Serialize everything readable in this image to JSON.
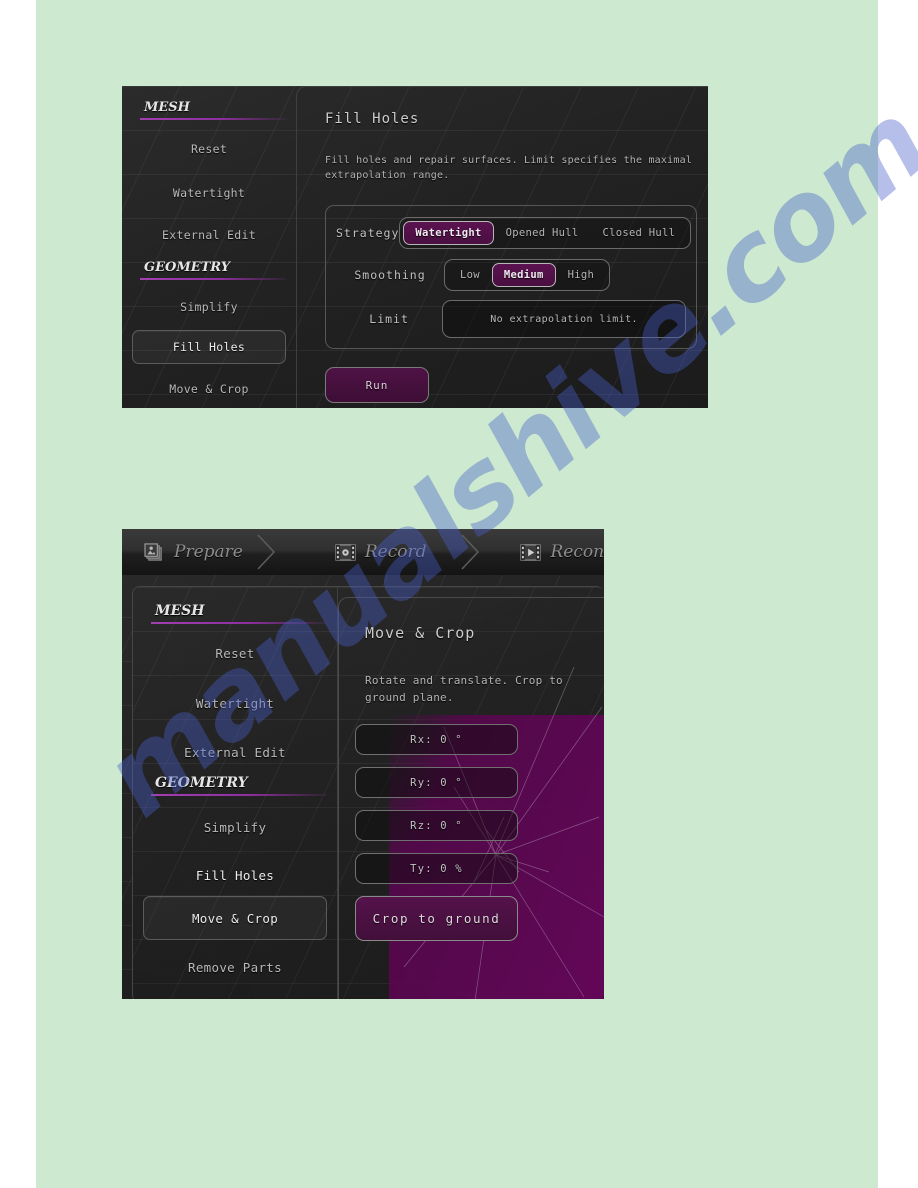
{
  "watermark": {
    "text": "manualshive.com"
  },
  "panel1": {
    "sidebar": {
      "sections": [
        {
          "heading": "MESH",
          "items": [
            {
              "label": "Reset",
              "selected": false
            },
            {
              "label": "Watertight",
              "selected": false
            },
            {
              "label": "External Edit",
              "selected": false
            }
          ]
        },
        {
          "heading": "GEOMETRY",
          "items": [
            {
              "label": "Simplify",
              "selected": false
            },
            {
              "label": "Fill Holes",
              "selected": true
            },
            {
              "label": "Move & Crop",
              "selected": false
            }
          ]
        }
      ]
    },
    "pane": {
      "title": "Fill Holes",
      "description": "Fill holes and repair surfaces. Limit specifies the maximal extrapolation range.",
      "rows": [
        {
          "label": "Strategy",
          "type": "segmented",
          "options": [
            "Watertight",
            "Opened Hull",
            "Closed Hull"
          ],
          "value": "Watertight"
        },
        {
          "label": "Smoothing",
          "type": "segmented",
          "options": [
            "Low",
            "Medium",
            "High"
          ],
          "value": "Medium"
        },
        {
          "label": "Limit",
          "type": "field",
          "value": "No extrapolation limit."
        }
      ],
      "run_label": "Run"
    }
  },
  "panel2": {
    "tabs": [
      {
        "label": "Prepare",
        "icon": "stacked-cards-icon"
      },
      {
        "label": "Record",
        "icon": "film-record-icon"
      },
      {
        "label": "Recon",
        "icon": "film-play-icon"
      }
    ],
    "sidebar": {
      "sections": [
        {
          "heading": "MESH",
          "items": [
            {
              "label": "Reset",
              "selected": false
            },
            {
              "label": "Watertight",
              "selected": false
            },
            {
              "label": "External Edit",
              "selected": false
            }
          ]
        },
        {
          "heading": "GEOMETRY",
          "items": [
            {
              "label": "Simplify",
              "selected": false
            },
            {
              "label": "Fill Holes",
              "selected": false
            },
            {
              "label": "Move & Crop",
              "selected": true
            },
            {
              "label": "Remove Parts",
              "selected": false
            }
          ]
        }
      ]
    },
    "pane": {
      "title": "Move & Crop",
      "description": "Rotate and translate. Crop to ground plane.",
      "fields": [
        {
          "label": "Rx: 0 °"
        },
        {
          "label": "Ry: 0 °"
        },
        {
          "label": "Rz: 0 °"
        },
        {
          "label": "Ty: 0 %"
        }
      ],
      "crop_label": "Crop to ground"
    }
  },
  "colors": {
    "page_background": "#cde9cf",
    "panel_background": "#1c1c1c",
    "accent_purple": "#a23fb0",
    "selected_fill": "#4f1245",
    "watermark_blue": "#465fc8"
  }
}
